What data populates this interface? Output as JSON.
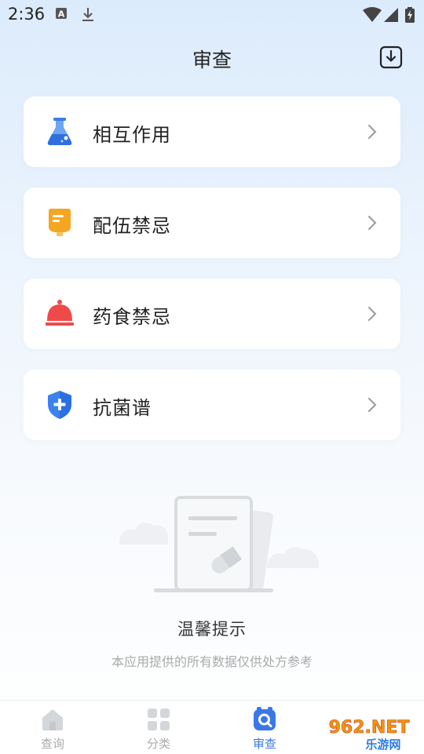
{
  "status_bar": {
    "time": "2:36"
  },
  "header": {
    "title": "审查",
    "download_icon": "download-box-icon"
  },
  "cards": [
    {
      "label": "相互作用",
      "icon": "flask-icon"
    },
    {
      "label": "配伍禁忌",
      "icon": "infusion-bag-icon"
    },
    {
      "label": "药食禁忌",
      "icon": "bell-cover-icon"
    },
    {
      "label": "抗菌谱",
      "icon": "shield-plus-icon"
    }
  ],
  "empty_state": {
    "title": "温馨提示",
    "subtitle": "本应用提供的所有数据仅供处方参考"
  },
  "tabbar": {
    "tabs": [
      {
        "label": "查询",
        "icon": "home-icon",
        "active": false
      },
      {
        "label": "分类",
        "icon": "grid-icon",
        "active": false
      },
      {
        "label": "审查",
        "icon": "review-icon",
        "active": true
      }
    ]
  },
  "watermark": {
    "text_top": "962.NET",
    "text_bottom": "乐游网"
  },
  "colors": {
    "accent": "#3b78e7",
    "flask": "#3a7ee8",
    "bag": "#f5a623",
    "bell": "#ef4a4a",
    "shield": "#3b82ef"
  }
}
